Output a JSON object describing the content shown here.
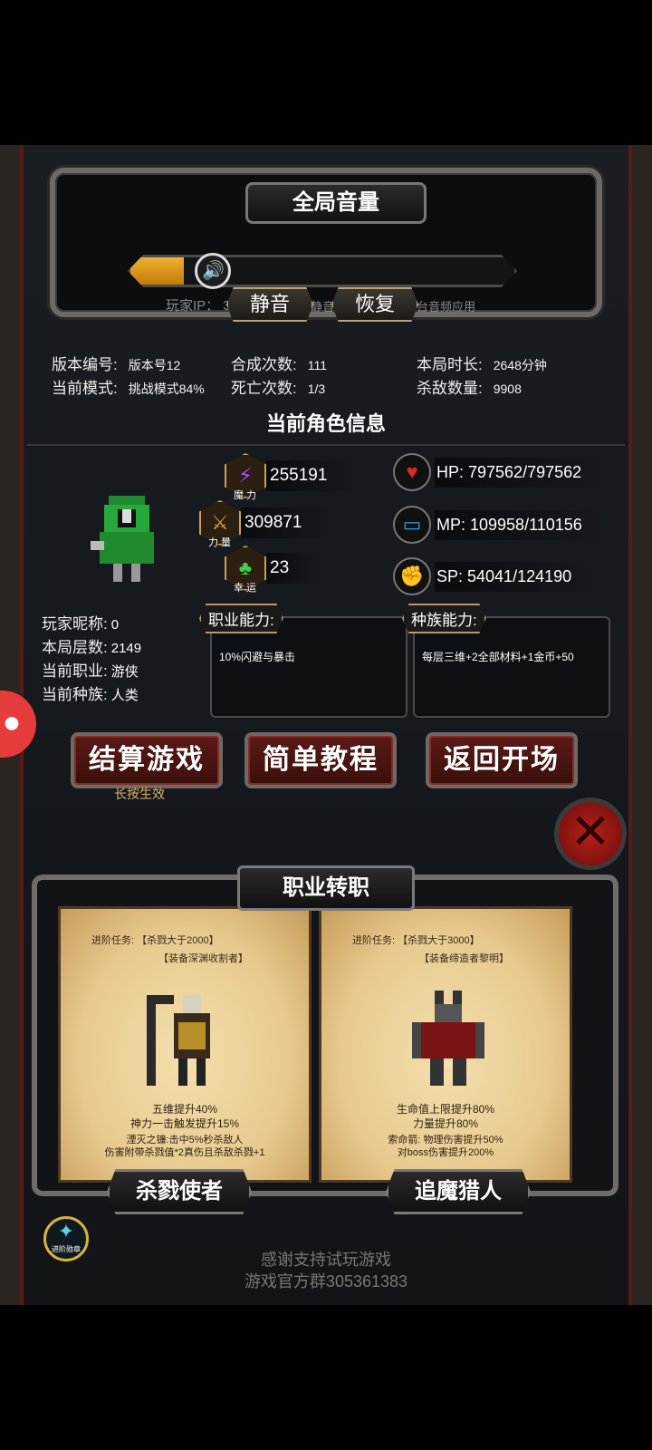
{
  "volume": {
    "title": "全局音量",
    "level": 0.08,
    "speaker_icon": "🔊",
    "player_ip": "玩家IP： 32976150",
    "hint": "设置静音时候可以使用后台音频应用",
    "mute_label": "静音",
    "restore_label": "恢复"
  },
  "stats": {
    "version_k": "版本编号:",
    "version_v": "版本号12",
    "mode_k": "当前模式:",
    "mode_v": "挑战模式84%",
    "craft_k": "合成次数:",
    "craft_v": "111",
    "death_k": "死亡次数:",
    "death_v": "1/3",
    "time_k": "本局时长:",
    "time_v": "2648分钟",
    "kills_k": "杀敌数量:",
    "kills_v": "9908"
  },
  "character": {
    "section_title": "当前角色信息",
    "magic_value": "255191",
    "magic_label": "魔 力",
    "magic_icon": "⚡",
    "power_value": "309871",
    "power_label": "力 量",
    "power_icon": "⚔",
    "luck_value": "23",
    "luck_label": "幸 运",
    "luck_icon": "♣",
    "hp": "HP:  797562/797562",
    "mp": "MP:  109958/110156",
    "sp": "SP:  54041/124190",
    "nickname_k": "玩家昵称:",
    "nickname_v": "0",
    "floor_k": "本局层数:",
    "floor_v": "2149",
    "job_k": "当前职业:",
    "job_v": "游侠",
    "race_k": "当前种族:",
    "race_v": "人类",
    "job_ability_tag": "职业能力:",
    "job_ability_text": "10%闪避与暴击",
    "race_ability_tag": "种族能力:",
    "race_ability_text": "每层三维+2全部材料+1金币+50"
  },
  "actions": {
    "settle": "结算游戏",
    "settle_sub": "长按生效",
    "tutorial": "简单教程",
    "back": "返回开场"
  },
  "job_change": {
    "title": "职业转职",
    "left": {
      "quest1": "进阶任务:  【杀戮大于2000】",
      "quest2": "【装备深渊收割者】",
      "line1": "五维提升40%",
      "line2": "神力一击触发提升15%",
      "line3": "湮灭之镰:击中5%秒杀敌人",
      "line4": "伤害附带杀戮值*2真伤且杀敌杀戮+1",
      "name": "杀戮使者"
    },
    "right": {
      "quest1": "进阶任务:  【杀戮大于3000】",
      "quest2": "【装备缔造者黎明】",
      "line1": "生命值上限提升80%",
      "line2": "力量提升80%",
      "line3": "索命箭: 物理伤害提升50%",
      "line4": "对boss伤害提升200%",
      "name": "追魔猎人"
    },
    "badge_label": "进阶勋章"
  },
  "footer": {
    "thanks": "感谢支持试玩游戏",
    "group": "游戏官方群305361383"
  }
}
